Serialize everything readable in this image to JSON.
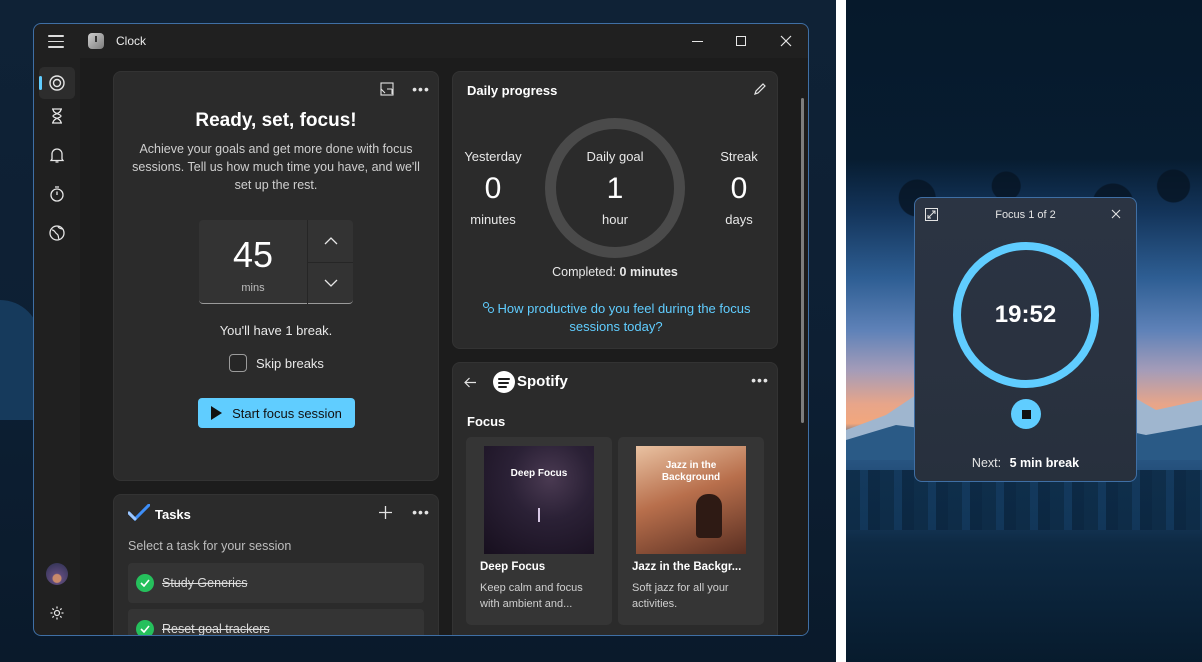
{
  "app": {
    "title": "Clock"
  },
  "titlebar": {
    "minimize_icon": "minimize-icon",
    "maximize_icon": "maximize-icon",
    "close_icon": "close-icon"
  },
  "nav": {
    "items": [
      {
        "name": "focus-sessions",
        "icon": "focus-icon",
        "active": true
      },
      {
        "name": "timer",
        "icon": "hourglass-icon",
        "active": false
      },
      {
        "name": "alarm",
        "icon": "bell-icon",
        "active": false
      },
      {
        "name": "stopwatch",
        "icon": "stopwatch-icon",
        "active": false
      },
      {
        "name": "world-clock",
        "icon": "globe-icon",
        "active": false
      }
    ],
    "bottom": [
      {
        "name": "account",
        "icon": "avatar"
      },
      {
        "name": "settings",
        "icon": "gear-icon"
      }
    ]
  },
  "focus": {
    "title": "Ready, set, focus!",
    "description": "Achieve your goals and get more done with focus sessions. Tell us how much time you have, and we'll set up the rest.",
    "minutes_value": "45",
    "minutes_unit": "mins",
    "break_text": "You'll have 1 break.",
    "skip_breaks_label": "Skip breaks",
    "skip_breaks_checked": false,
    "start_label": "Start focus session"
  },
  "tasks": {
    "title": "Tasks",
    "subtitle": "Select a task for your session",
    "items": [
      {
        "label": "Study Generics",
        "done": true
      },
      {
        "label": "Reset goal trackers",
        "done": true
      }
    ]
  },
  "daily_progress": {
    "title": "Daily progress",
    "yesterday": {
      "label": "Yesterday",
      "value": "0",
      "unit": "minutes"
    },
    "goal": {
      "label": "Daily goal",
      "value": "1",
      "unit": "hour"
    },
    "streak": {
      "label": "Streak",
      "value": "0",
      "unit": "days"
    },
    "completed_label": "Completed:",
    "completed_value": "0 minutes",
    "feedback_link": "How productive do you feel during the focus sessions today?"
  },
  "spotify": {
    "brand": "Spotify",
    "section": "Focus",
    "playlists": [
      {
        "cover_text": "Deep Focus",
        "title": "Deep Focus",
        "description": "Keep calm and focus with ambient and..."
      },
      {
        "cover_text": "Jazz in the Background",
        "title": "Jazz in the Backgr...",
        "description": "Soft jazz for all your activities."
      }
    ]
  },
  "mini": {
    "title": "Focus 1 of 2",
    "time": "19:52",
    "next_label": "Next:",
    "next_value": "5 min break"
  },
  "colors": {
    "accent": "#60cdff",
    "window_bg": "#202020",
    "card_bg": "#2b2b2b",
    "task_done": "#25c05c"
  }
}
